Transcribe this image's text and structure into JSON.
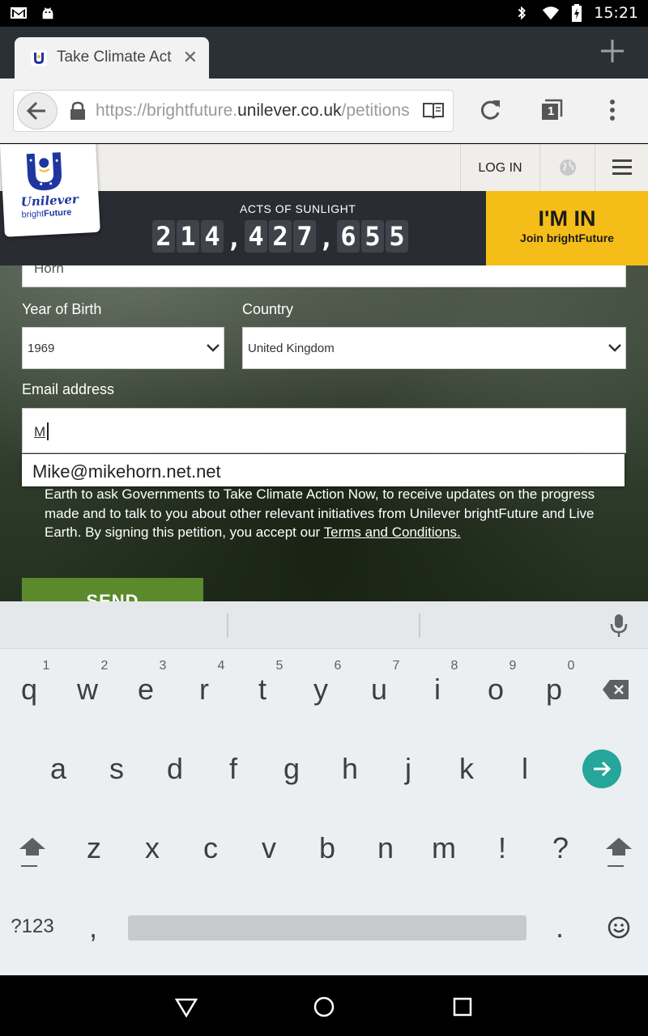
{
  "status_bar": {
    "time": "15:21",
    "icons": [
      "gmail-icon",
      "android-icon",
      "bluetooth-icon",
      "wifi-icon",
      "battery-charging-icon"
    ]
  },
  "browser": {
    "tab": {
      "title": "Take Climate Act"
    },
    "url": {
      "prefix": "https://brightfuture.",
      "host": "unilever.co.uk",
      "path": "/petitions"
    },
    "tab_count": "1"
  },
  "site": {
    "logo": {
      "brand": "Unilever",
      "sub_light": "bright",
      "sub_bold": "Future"
    },
    "login_label": "LOG IN",
    "counter": {
      "title": "ACTS OF SUNLIGHT",
      "digits": [
        "2",
        "1",
        "4",
        ",",
        "4",
        "2",
        "7",
        ",",
        "6",
        "5",
        "5"
      ]
    },
    "cta": {
      "title": "I'M IN",
      "subtitle": "Join brightFuture"
    }
  },
  "form": {
    "partial_field_value": "Horn",
    "year_label": "Year of Birth",
    "year_value": "1969",
    "country_label": "Country",
    "country_value": "United Kingdom",
    "email_label": "Email address",
    "email_value": "M",
    "autofill_suggestion": "Mike@mikehorn.net.net",
    "consent_text": "Earth to ask Governments to Take Climate Action Now, to receive updates on the progress made and to talk to you about other relevant initiatives from Unilever brightFuture and Live Earth. By signing this petition, you accept our ",
    "consent_link": "Terms and Conditions.",
    "send_label": "SEND"
  },
  "keyboard": {
    "hints": [
      "1",
      "2",
      "3",
      "4",
      "5",
      "6",
      "7",
      "8",
      "9",
      "0"
    ],
    "row1": [
      "q",
      "w",
      "e",
      "r",
      "t",
      "y",
      "u",
      "i",
      "o",
      "p"
    ],
    "row2": [
      "a",
      "s",
      "d",
      "f",
      "g",
      "h",
      "j",
      "k",
      "l"
    ],
    "row3": [
      "z",
      "x",
      "c",
      "v",
      "b",
      "n",
      "m",
      "!",
      "?"
    ],
    "symbols_label": "?123",
    "comma": ",",
    "period": "."
  }
}
